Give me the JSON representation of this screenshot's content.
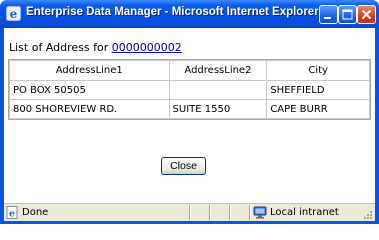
{
  "window": {
    "title": "Enterprise Data Manager - Microsoft Internet Explorer p..."
  },
  "page": {
    "heading_prefix": "List of Address for",
    "record_link": "0000000002"
  },
  "table": {
    "columns": [
      "AddressLine1",
      "AddressLine2",
      "City"
    ],
    "rows": [
      [
        "PO BOX 50505",
        "",
        "SHEFFIELD"
      ],
      [
        "800 SHOREVIEW RD.",
        "SUITE 1550",
        "CAPE BURR"
      ]
    ]
  },
  "buttons": {
    "close_label": "Close"
  },
  "status": {
    "left_text": "Done",
    "zone_text": "Local intranet"
  },
  "colors": {
    "titlebar": "#0450e2",
    "link": "#0000cc",
    "statusbar": "#ece9d8"
  }
}
